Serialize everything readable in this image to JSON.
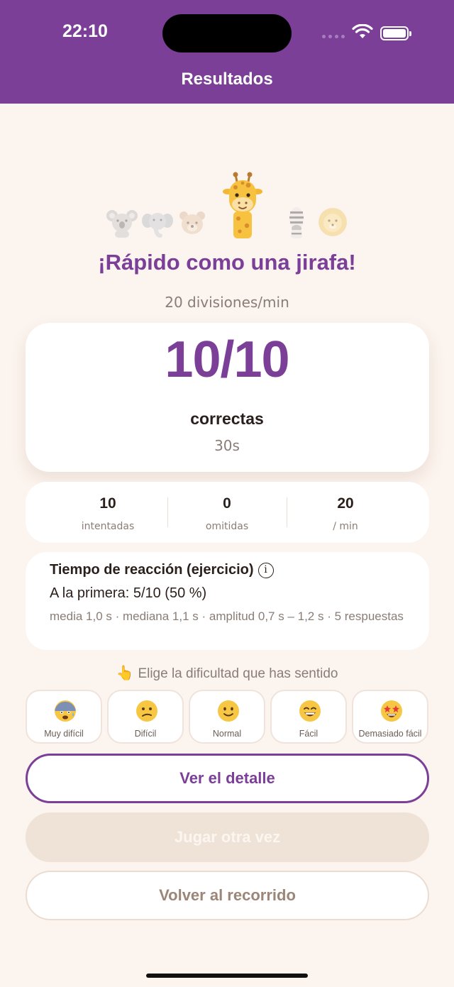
{
  "status_bar": {
    "time": "22:10"
  },
  "header": {
    "title": "Resultados"
  },
  "result": {
    "headline": "¡Rápido como una jirafa!",
    "rate": "20 divisiones/min",
    "score": "10/10",
    "score_label": "correctas",
    "duration": "30s"
  },
  "stats": [
    {
      "value": "10",
      "label": "intentadas"
    },
    {
      "value": "0",
      "label": "omitidas"
    },
    {
      "value": "20",
      "label": "/ min"
    }
  ],
  "reaction": {
    "title": "Tiempo de reacción (ejercicio)",
    "info_icon": "ⓘ",
    "first_try": "A la primera: 5/10 (50 %)",
    "details": "media 1,0 s · mediana 1,1 s · amplitud 0,7 s – 1,2 s · 5 respuestas"
  },
  "difficulty": {
    "prompt_icon": "👆",
    "prompt": "Elige la dificultad que has sentido",
    "options": [
      {
        "label": "Muy difícil",
        "icon": "anxious-face-icon"
      },
      {
        "label": "Difícil",
        "icon": "confused-face-icon"
      },
      {
        "label": "Normal",
        "icon": "slight-smile-icon"
      },
      {
        "label": "Fácil",
        "icon": "grin-face-icon"
      },
      {
        "label": "Demasiado fácil",
        "icon": "star-struck-icon"
      }
    ]
  },
  "actions": {
    "detail": "Ver el detalle",
    "replay": "Jugar otra vez",
    "back": "Volver al recorrido"
  },
  "colors": {
    "header": "#7b3f98",
    "accent": "#7b3f98",
    "background": "#fcf4ef",
    "muted_text": "#8a7d76"
  }
}
